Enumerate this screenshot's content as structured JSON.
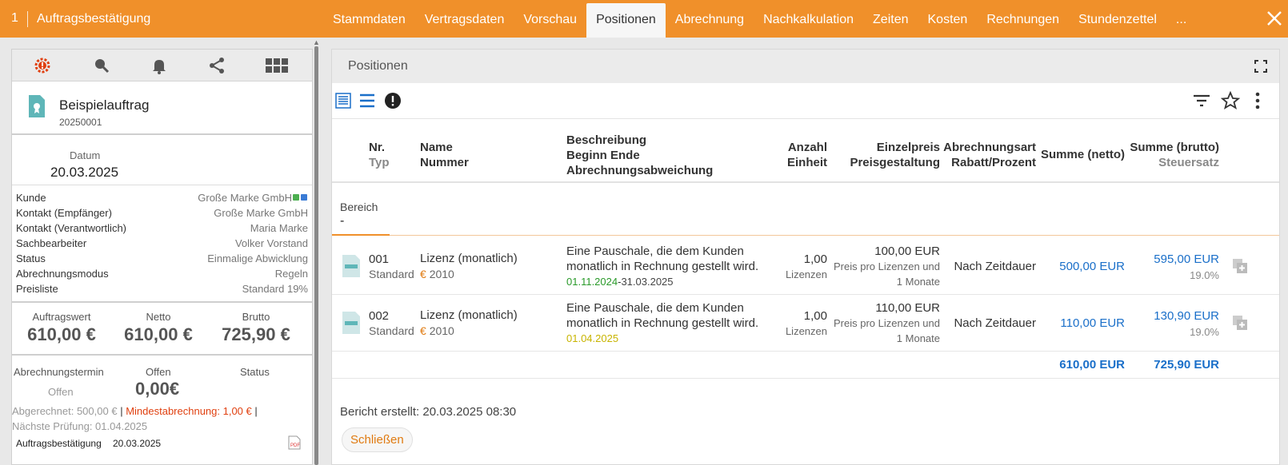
{
  "topbar": {
    "number": "1",
    "title": "Auftragsbestätigung",
    "tabs": [
      {
        "label": "Stammdaten"
      },
      {
        "label": "Vertragsdaten"
      },
      {
        "label": "Vorschau"
      },
      {
        "label": "Positionen",
        "active": true
      },
      {
        "label": "Abrechnung"
      },
      {
        "label": "Nachkalkulation"
      },
      {
        "label": "Zeiten"
      },
      {
        "label": "Kosten"
      },
      {
        "label": "Rechnungen"
      },
      {
        "label": "Stundenzettel"
      },
      {
        "label": "..."
      }
    ]
  },
  "left": {
    "toolbar_icons": [
      "alert-gear-icon",
      "search-icon",
      "bell-icon",
      "share-icon",
      "grid-icon"
    ],
    "order_name": "Beispielauftrag",
    "order_number": "20250001",
    "date_label": "Datum",
    "date_value": "20.03.2025",
    "fields": [
      {
        "key": "Kunde",
        "value": "Große Marke GmbH"
      },
      {
        "key": "Kontakt (Empfänger)",
        "value": "Große Marke GmbH"
      },
      {
        "key": "Kontakt (Verantwortlich)",
        "value": "Maria Marke"
      },
      {
        "key": "Sachbearbeiter",
        "value": "Volker Vorstand"
      },
      {
        "key": "Status",
        "value": "Einmalige Abwicklung"
      },
      {
        "key": "Abrechnungsmodus",
        "value": "Regeln"
      },
      {
        "key": "Preisliste",
        "value": "Standard 19%"
      }
    ],
    "amounts": {
      "auftragswert_label": "Auftragswert",
      "auftragswert": "610,00 €",
      "netto_label": "Netto",
      "netto": "610,00 €",
      "brutto_label": "Brutto",
      "brutto": "725,90 €"
    },
    "billing": {
      "termin_label": "Abrechnungstermin",
      "offen_label": "Offen",
      "status_label": "Status",
      "termin_value": "Offen",
      "offen_value": "0,00€",
      "abgerechnet": "Abgerechnet: 500,00 €",
      "pipe": "|",
      "mindest": "Mindestabrechnung: 1,00  €",
      "pipe2": "|",
      "naechste": "Nächste Prüfung: 01.04.2025",
      "doc_label": "Auftragsbestätigung",
      "doc_date": "20.03.2025"
    }
  },
  "right": {
    "title": "Positionen",
    "headers": {
      "nr": "Nr.",
      "typ": "Typ",
      "name": "Name",
      "nummer": "Nummer",
      "beschreibung": "Beschreibung",
      "beginn_ende": "Beginn Ende",
      "abweichung": "Abrechnungsabweichung",
      "anzahl": "Anzahl",
      "einheit": "Einheit",
      "einzelpreis": "Einzelpreis",
      "preisgestaltung": "Preisgestaltung",
      "abrechnungsart": "Abrechnungsart",
      "rabatt": "Rabatt/Prozent",
      "summe_netto": "Summe (netto)",
      "summe_brutto": "Summe (brutto)",
      "steuersatz": "Steuersatz"
    },
    "bereich_label": "Bereich",
    "bereich_value": "-",
    "rows": [
      {
        "nr": "001",
        "typ": "Standard",
        "name": "Lizenz (monatlich)",
        "nummer": "2010",
        "desc1": "Eine Pauschale, die dem Kunden",
        "desc2": "monatlich in Rechnung gestellt wird.",
        "beginn": "01.11.2024",
        "dash": "-",
        "ende": "31.03.2025",
        "anzahl": "1,00",
        "einheit": "Lizenzen",
        "einzelpreis": "100,00 EUR",
        "preis1": "Preis pro Lizenzen und",
        "preis2": "1 Monate",
        "abrechnungsart": "Nach Zeitdauer",
        "summe_netto": "500,00 EUR",
        "summe_brutto": "595,00 EUR",
        "steuer": "19.0%"
      },
      {
        "nr": "002",
        "typ": "Standard",
        "name": "Lizenz (monatlich)",
        "nummer": "2010",
        "desc1": "Eine Pauschale, die dem Kunden",
        "desc2": "monatlich in Rechnung gestellt wird.",
        "beginn": "01.04.2025",
        "dash": "",
        "ende": "",
        "anzahl": "1,00",
        "einheit": "Lizenzen",
        "einzelpreis": "110,00 EUR",
        "preis1": "Preis pro Lizenzen und",
        "preis2": "1 Monate",
        "abrechnungsart": "Nach Zeitdauer",
        "summe_netto": "110,00 EUR",
        "summe_brutto": "130,90 EUR",
        "steuer": "19.0%"
      }
    ],
    "total_netto": "610,00 EUR",
    "total_brutto": "725,90 EUR",
    "report": "Bericht erstellt: 20.03.2025 08:30",
    "close_button": "Schließen"
  },
  "colors": {
    "accent": "#f0902a",
    "link": "#1a6fc9",
    "alert": "#e04010",
    "date_green": "#2a9a2a",
    "date_yellow": "#c8b400"
  }
}
